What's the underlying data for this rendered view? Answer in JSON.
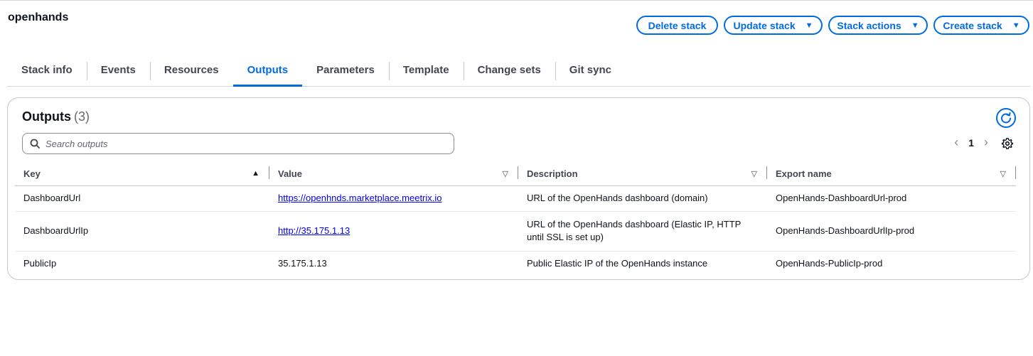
{
  "stack": {
    "title": "openhands"
  },
  "header_actions": {
    "delete": "Delete stack",
    "update": "Update stack",
    "actions": "Stack actions",
    "create": "Create stack"
  },
  "tabs": [
    "Stack info",
    "Events",
    "Resources",
    "Outputs",
    "Parameters",
    "Template",
    "Change sets",
    "Git sync"
  ],
  "active_tab": "Outputs",
  "outputs": {
    "title": "Outputs",
    "count": "(3)",
    "search_placeholder": "Search outputs",
    "page": "1",
    "columns": [
      "Key",
      "Value",
      "Description",
      "Export name"
    ],
    "rows": [
      {
        "key": "DashboardUrl",
        "value": "https://openhnds.marketplace.meetrix.io",
        "value_is_link": true,
        "description": "URL of the OpenHands dashboard (domain)",
        "export": "OpenHands-DashboardUrl-prod"
      },
      {
        "key": "DashboardUrlIp",
        "value": "http://35.175.1.13",
        "value_is_link": true,
        "description": "URL of the OpenHands dashboard (Elastic IP, HTTP until SSL is set up)",
        "export": "OpenHands-DashboardUrlIp-prod"
      },
      {
        "key": "PublicIp",
        "value": "35.175.1.13",
        "value_is_link": false,
        "description": "Public Elastic IP of the OpenHands instance",
        "export": "OpenHands-PublicIp-prod"
      }
    ]
  },
  "icons": {
    "refresh": "refresh-icon",
    "search": "search-icon",
    "settings": "gear-icon",
    "sort_asc": "sort-ascending-icon",
    "sort": "sort-icon"
  },
  "colors": {
    "accent": "#006ce0",
    "link": "#0000ee",
    "text": "#0f141a"
  }
}
